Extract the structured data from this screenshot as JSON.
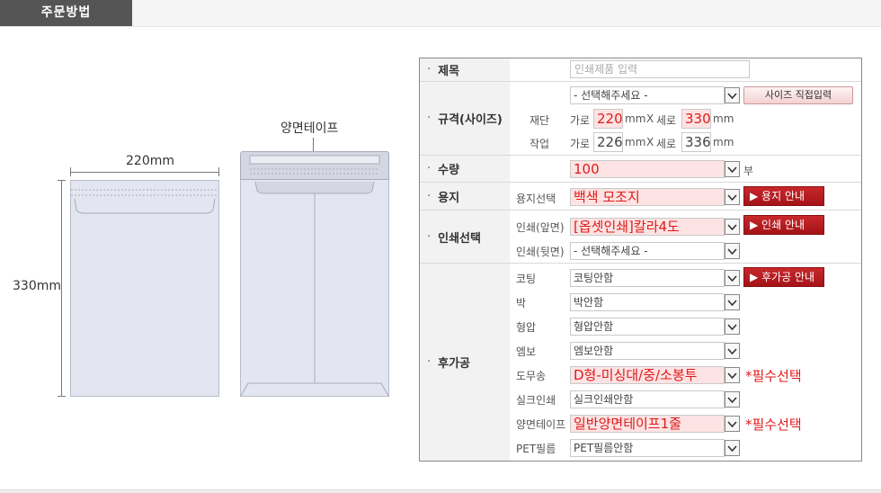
{
  "header": {
    "tab_label": "주문방법"
  },
  "illustration": {
    "width_label": "220mm",
    "height_label": "330mm",
    "tape_label": "양면테이프"
  },
  "form": {
    "title": {
      "label": "제목",
      "placeholder": "인쇄제품 입력"
    },
    "size": {
      "label": "규격(사이즈)",
      "select_value": "- 선택해주세요 -",
      "custom_button": "사이즈 직접입력",
      "cut": {
        "label": "재단",
        "w_label": "가로",
        "w_value": "220",
        "h_label": "세로",
        "h_value": "330",
        "unit": "mm",
        "x": "X"
      },
      "work": {
        "label": "작업",
        "w_label": "가로",
        "w_value": "226",
        "h_label": "세로",
        "h_value": "336",
        "unit": "mm",
        "x": "X"
      }
    },
    "quantity": {
      "label": "수량",
      "value": "100",
      "unit": "부"
    },
    "paper": {
      "label": "용지",
      "row_label": "용지선택",
      "value": "백색 모조지",
      "guide_button": "▶ 용지 안내"
    },
    "print": {
      "label": "인쇄선택",
      "front_label": "인쇄(앞면)",
      "front_value": "[옵셋인쇄]칼라4도",
      "guide_button": "▶ 인쇄 안내",
      "back_label": "인쇄(뒷면)",
      "back_value": "- 선택해주세요 -"
    },
    "post": {
      "label": "후가공",
      "guide_button": "▶ 후가공 안내",
      "required_text": "*필수선택",
      "rows": [
        {
          "label": "코팅",
          "value": "코팅안함"
        },
        {
          "label": "박",
          "value": "박안함"
        },
        {
          "label": "형압",
          "value": "형압안함"
        },
        {
          "label": "엠보",
          "value": "엠보안함"
        },
        {
          "label": "도무송",
          "value": "D형-미싱대/중/소봉투"
        },
        {
          "label": "실크인쇄",
          "value": "실크인쇄안함"
        },
        {
          "label": "양면테이프",
          "value": "일반양면테이프1줄"
        },
        {
          "label": "PET필름",
          "value": "PET필름안함"
        }
      ]
    }
  }
}
